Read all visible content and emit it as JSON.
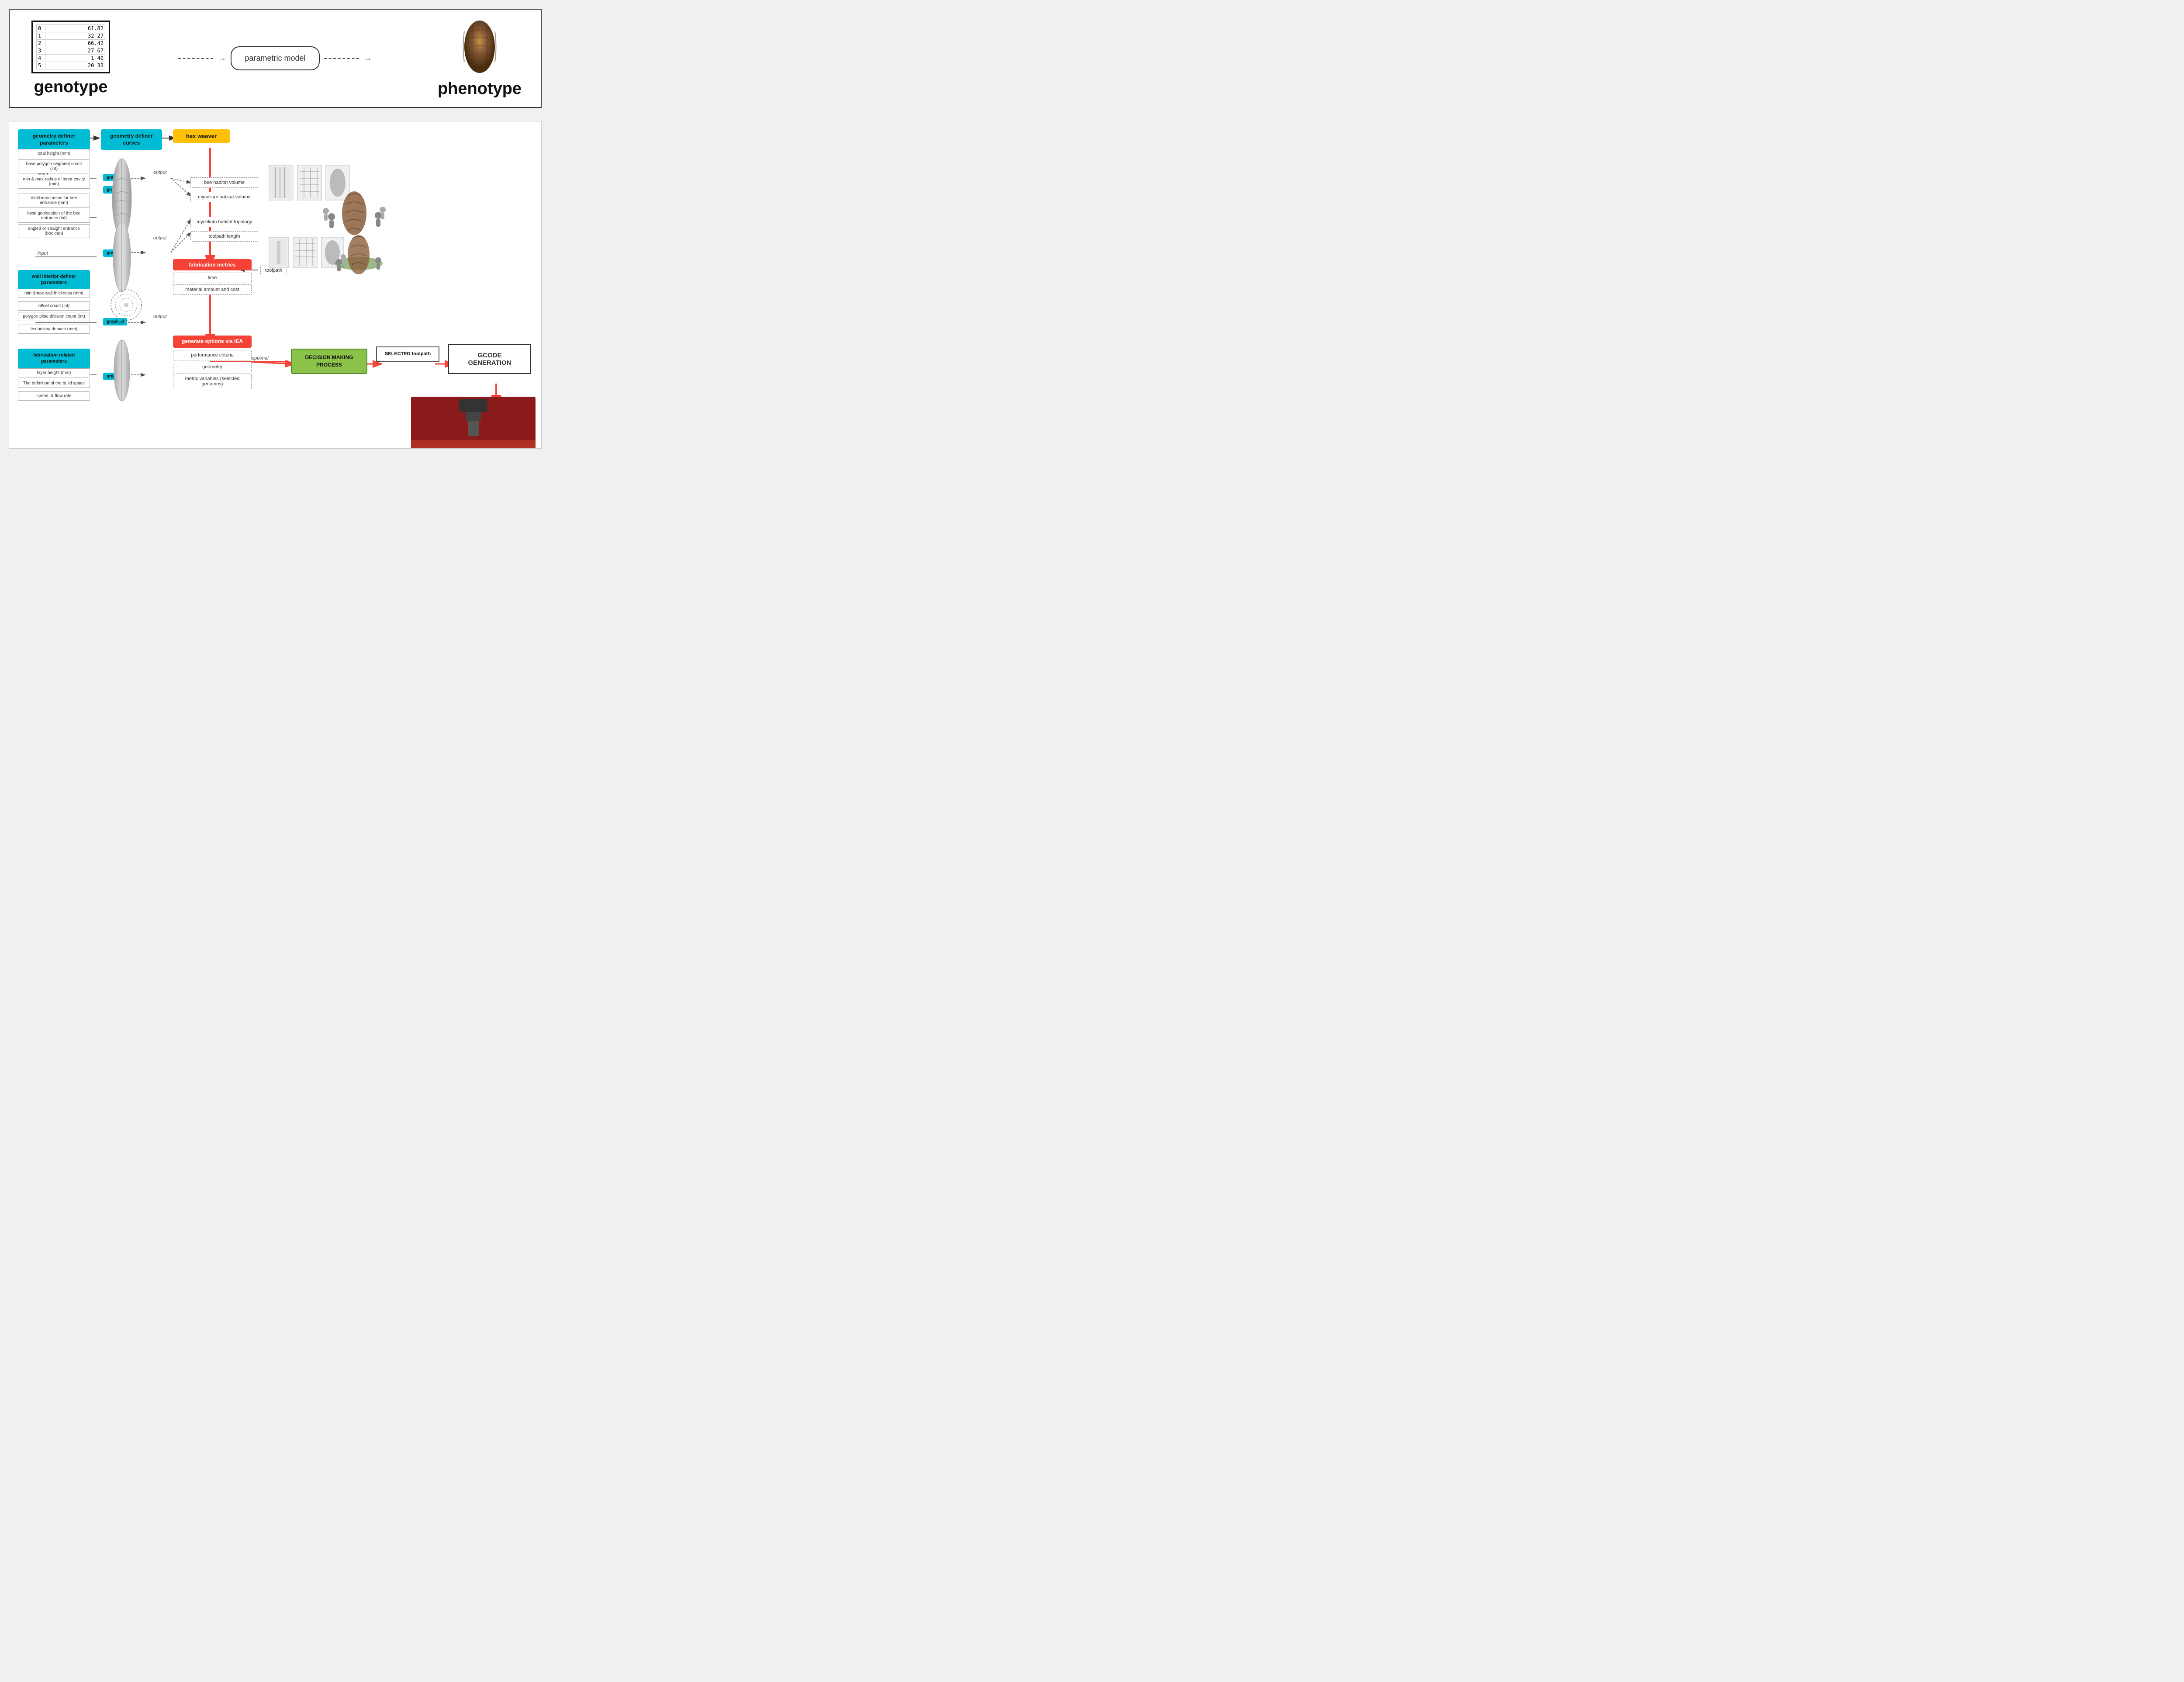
{
  "top": {
    "genotype_label": "genotype",
    "phenotype_label": "phenotype",
    "parametric_model_label": "parametric model",
    "genotype_table": {
      "rows": [
        {
          "idx": "0",
          "val": "61.82"
        },
        {
          "idx": "1",
          "val": "32 27"
        },
        {
          "idx": "2",
          "val": "66.42"
        },
        {
          "idx": "3",
          "val": "27 67"
        },
        {
          "idx": "4",
          "val": "1 40"
        },
        {
          "idx": "5",
          "val": "20 33"
        }
      ]
    }
  },
  "bottom": {
    "nodes": {
      "geometry_definer_params": "geometry definer\nparameters",
      "geometry_definer_curves": "geometry definer\ncurves",
      "hex_weaver": "hex weaver",
      "fabrication_metrics": "fabrication metrics",
      "generate_options": "generate options via\nIEA",
      "decision_making": "DECISION MAKING\nPROCESS",
      "selected_toolpath": "SELECTED\ntoolpath",
      "gcode_generation": "GCODE GENERATION",
      "wall_interior_definer": "wall interior definer\nparameters",
      "fabrication_related": "fabrication related\nparameters"
    },
    "graph_nodes": {
      "graph_a": "graph_a",
      "graph_b": "graph_b",
      "graph_c": "graph_c",
      "graph_d": "graph_d",
      "graph_e": "graph_e"
    },
    "outputs": {
      "bee_habitat_volume": "bee habitat volume",
      "mycelium_habitat_volume": "mycelium habitat volume",
      "mycelium_habitat_topology": "mycelium habitat topology",
      "toolpath_length": "toolpath length",
      "time": "time",
      "material_amount_cost": "material amount and cost",
      "performance_criteria": "performance\ncriteria",
      "geometry": "geometry",
      "metric_variables": "metric variables\n(selected genomes)"
    },
    "labels": {
      "input": "input",
      "output": "output",
      "toolpath": "toolpath",
      "optional": "optional"
    },
    "params": {
      "geometry_definer": [
        "total height (mm)",
        "base polygon segment count (int)",
        "min & max radius of inner cavity (mm)",
        "min&max radius for bee entrance (mm)",
        "local geolocation of the bee entrance (int)",
        "angled or straight entrance (boolean)"
      ],
      "wall_interior": [
        "min &max wall thickness (mm)",
        "offset count (int)",
        "polygon pline division count (int)",
        "texturising domain (mm)"
      ],
      "fabrication": [
        "layer height (mm)",
        "The definition of the build space",
        "speed, & flow rate"
      ]
    }
  }
}
